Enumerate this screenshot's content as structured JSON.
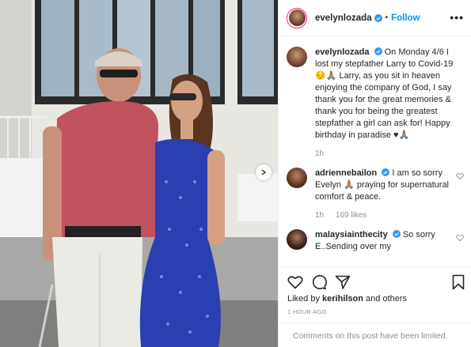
{
  "post": {
    "username": "evelynlozada",
    "follow_label": "Follow",
    "separator": "•",
    "more_label": "•••"
  },
  "caption": {
    "username": "evelynlozada",
    "text": "On Monday 4/6 I lost my stepfather Larry to Covid-19 😔🙏🏽 Larry, as you sit in heaven enjoying the company of God, I say thank you for the great memories & thank you for being the greatest stepfather a girl can ask for! Happy birthday in paradise ♥🙏🏽",
    "age": "1h"
  },
  "comments": [
    {
      "username": "adriennebailon",
      "text": "I am so sorry Evelyn 🙏🏽 praying for supernatural comfort & peace.",
      "age": "1h",
      "likes": "169 likes"
    },
    {
      "username": "malaysiainthecity",
      "text": "So sorry E..Sending over my"
    }
  ],
  "footer": {
    "liked_by_prefix": "Liked by ",
    "liked_by_user": "kerihilson",
    "liked_by_suffix": " and others",
    "time": "1 HOUR AGO",
    "comments_limited": "Comments on this post have been limited."
  },
  "icons": {
    "verified": "verified-badge-icon",
    "like": "heart-icon",
    "comment": "comment-icon",
    "share": "paper-plane-icon",
    "save": "bookmark-icon",
    "next": "chevron-right-icon"
  },
  "colors": {
    "accent": "#0095f6",
    "muted": "#8e8e8e",
    "text": "#262626"
  }
}
